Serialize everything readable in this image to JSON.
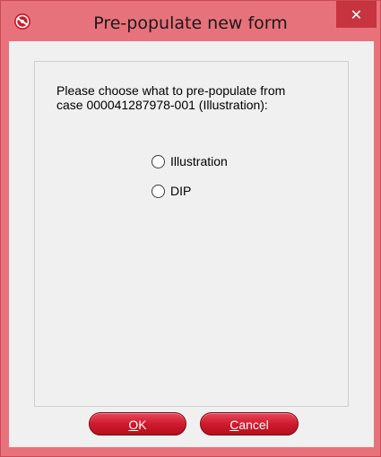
{
  "window": {
    "title": "Pre-populate new form",
    "close_glyph": "✕"
  },
  "icons": {
    "app": "app-logo-icon",
    "close": "close-icon"
  },
  "dialog": {
    "prompt_line1": "Please choose what to pre-populate from",
    "prompt_line2": "case 000041287978-001 (Illustration):",
    "options": [
      {
        "label": "Illustration",
        "selected": false
      },
      {
        "label": "DIP",
        "selected": false
      }
    ]
  },
  "buttons": {
    "ok": {
      "mnemonic": "O",
      "rest": "K"
    },
    "cancel": {
      "mnemonic": "C",
      "rest": "ancel"
    }
  },
  "colors": {
    "frame": "#e8727b",
    "close_button": "#c7333f",
    "button_red": "#cf1a2e"
  }
}
